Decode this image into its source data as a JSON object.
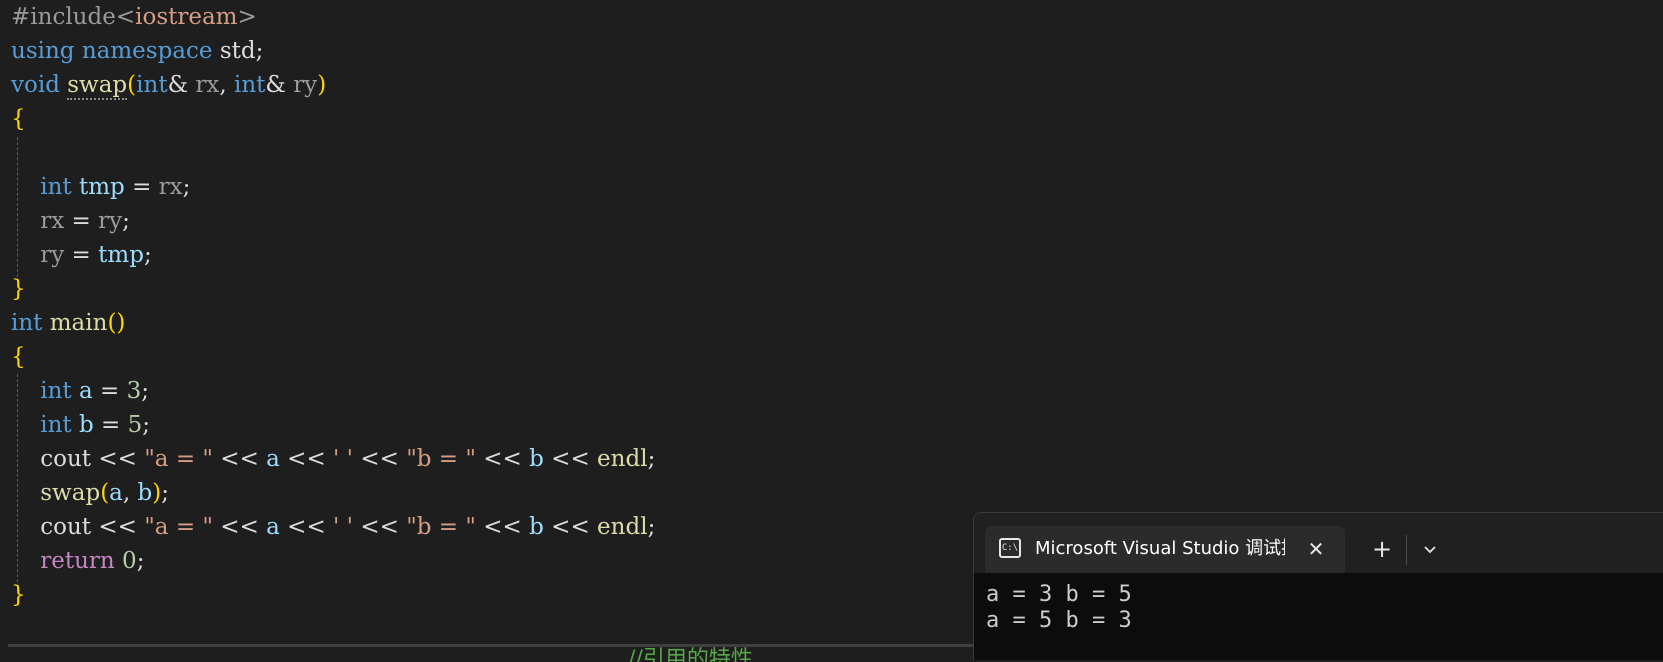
{
  "code": {
    "lines": [
      [
        {
          "t": "#include",
          "c": "p"
        },
        {
          "t": "<",
          "c": "p"
        },
        {
          "t": "iostream",
          "c": "s"
        },
        {
          "t": ">",
          "c": "p"
        }
      ],
      [
        {
          "t": "using",
          "c": "k"
        },
        {
          "t": " ",
          "c": "w"
        },
        {
          "t": "namespace",
          "c": "k"
        },
        {
          "t": " std;",
          "c": "o"
        }
      ],
      [
        {
          "t": "void",
          "c": "k"
        },
        {
          "t": " ",
          "c": "w"
        },
        {
          "t": "swap",
          "c": "f",
          "squiggle": true
        },
        {
          "t": "(",
          "c": "b"
        },
        {
          "t": "int",
          "c": "k"
        },
        {
          "t": "& ",
          "c": "o"
        },
        {
          "t": "rx",
          "c": "m"
        },
        {
          "t": ", ",
          "c": "o"
        },
        {
          "t": "int",
          "c": "k"
        },
        {
          "t": "& ",
          "c": "o"
        },
        {
          "t": "ry",
          "c": "m"
        },
        {
          "t": ")",
          "c": "b"
        }
      ],
      [
        {
          "t": "{",
          "c": "b"
        }
      ],
      [],
      [
        {
          "t": "    ",
          "c": "w"
        },
        {
          "t": "int",
          "c": "k"
        },
        {
          "t": " ",
          "c": "w"
        },
        {
          "t": "tmp",
          "c": "v"
        },
        {
          "t": " = ",
          "c": "o"
        },
        {
          "t": "rx",
          "c": "m"
        },
        {
          "t": ";",
          "c": "o"
        }
      ],
      [
        {
          "t": "    ",
          "c": "w"
        },
        {
          "t": "rx",
          "c": "m"
        },
        {
          "t": " = ",
          "c": "o"
        },
        {
          "t": "ry",
          "c": "m"
        },
        {
          "t": ";",
          "c": "o"
        }
      ],
      [
        {
          "t": "    ",
          "c": "w"
        },
        {
          "t": "ry",
          "c": "m"
        },
        {
          "t": " = ",
          "c": "o"
        },
        {
          "t": "tmp",
          "c": "v"
        },
        {
          "t": ";",
          "c": "o"
        }
      ],
      [
        {
          "t": "}",
          "c": "b"
        }
      ],
      [
        {
          "t": "int",
          "c": "k"
        },
        {
          "t": " ",
          "c": "w"
        },
        {
          "t": "main",
          "c": "f"
        },
        {
          "t": "()",
          "c": "b"
        }
      ],
      [
        {
          "t": "{",
          "c": "b"
        }
      ],
      [
        {
          "t": "    ",
          "c": "w"
        },
        {
          "t": "int",
          "c": "k"
        },
        {
          "t": " ",
          "c": "w"
        },
        {
          "t": "a",
          "c": "v"
        },
        {
          "t": " = ",
          "c": "o"
        },
        {
          "t": "3",
          "c": "n"
        },
        {
          "t": ";",
          "c": "o"
        }
      ],
      [
        {
          "t": "    ",
          "c": "w"
        },
        {
          "t": "int",
          "c": "k"
        },
        {
          "t": " ",
          "c": "w"
        },
        {
          "t": "b",
          "c": "v"
        },
        {
          "t": " = ",
          "c": "o"
        },
        {
          "t": "5",
          "c": "n"
        },
        {
          "t": ";",
          "c": "o"
        }
      ],
      [
        {
          "t": "    ",
          "c": "w"
        },
        {
          "t": "cout",
          "c": "o"
        },
        {
          "t": " << ",
          "c": "o"
        },
        {
          "t": "\"a = \"",
          "c": "s"
        },
        {
          "t": " << ",
          "c": "o"
        },
        {
          "t": "a",
          "c": "v"
        },
        {
          "t": " << ",
          "c": "o"
        },
        {
          "t": "' '",
          "c": "s"
        },
        {
          "t": " << ",
          "c": "o"
        },
        {
          "t": "\"b = \"",
          "c": "s"
        },
        {
          "t": " << ",
          "c": "o"
        },
        {
          "t": "b",
          "c": "v"
        },
        {
          "t": " << ",
          "c": "o"
        },
        {
          "t": "endl",
          "c": "f"
        },
        {
          "t": ";",
          "c": "o"
        }
      ],
      [
        {
          "t": "    ",
          "c": "w"
        },
        {
          "t": "swap",
          "c": "f"
        },
        {
          "t": "(",
          "c": "b"
        },
        {
          "t": "a",
          "c": "v"
        },
        {
          "t": ", ",
          "c": "o"
        },
        {
          "t": "b",
          "c": "v"
        },
        {
          "t": ")",
          "c": "b"
        },
        {
          "t": ";",
          "c": "o"
        }
      ],
      [
        {
          "t": "    ",
          "c": "w"
        },
        {
          "t": "cout",
          "c": "o"
        },
        {
          "t": " << ",
          "c": "o"
        },
        {
          "t": "\"a = \"",
          "c": "s"
        },
        {
          "t": " << ",
          "c": "o"
        },
        {
          "t": "a",
          "c": "v"
        },
        {
          "t": " << ",
          "c": "o"
        },
        {
          "t": "' '",
          "c": "s"
        },
        {
          "t": " << ",
          "c": "o"
        },
        {
          "t": "\"b = \"",
          "c": "s"
        },
        {
          "t": " << ",
          "c": "o"
        },
        {
          "t": "b",
          "c": "v"
        },
        {
          "t": " << ",
          "c": "o"
        },
        {
          "t": "endl",
          "c": "f"
        },
        {
          "t": ";",
          "c": "o"
        }
      ],
      [
        {
          "t": "    ",
          "c": "w"
        },
        {
          "t": "return",
          "c": "c"
        },
        {
          "t": " ",
          "c": "w"
        },
        {
          "t": "0",
          "c": "n"
        },
        {
          "t": ";",
          "c": "o"
        }
      ],
      [
        {
          "t": "}",
          "c": "b"
        }
      ]
    ],
    "bottom_fragment": "//引用的特性"
  },
  "terminal": {
    "tab_icon_text": "C:\\",
    "tab_title": "Microsoft Visual Studio 调试控制台",
    "close_icon": "close-icon",
    "new_tab_symbol": "+",
    "output_lines": [
      "a = 3 b = 5",
      "a = 5 b = 3"
    ]
  },
  "colors": {
    "editor_bg": "#1e1e1e",
    "keyword": "#569cd6",
    "function": "#dcdcaa",
    "bracket": "#ffd700",
    "variable": "#9cdcfe",
    "string": "#d69d85",
    "number": "#b5cea8",
    "control": "#c586c0",
    "comment": "#57a64a",
    "terminal_bg": "#0c0c0c"
  }
}
